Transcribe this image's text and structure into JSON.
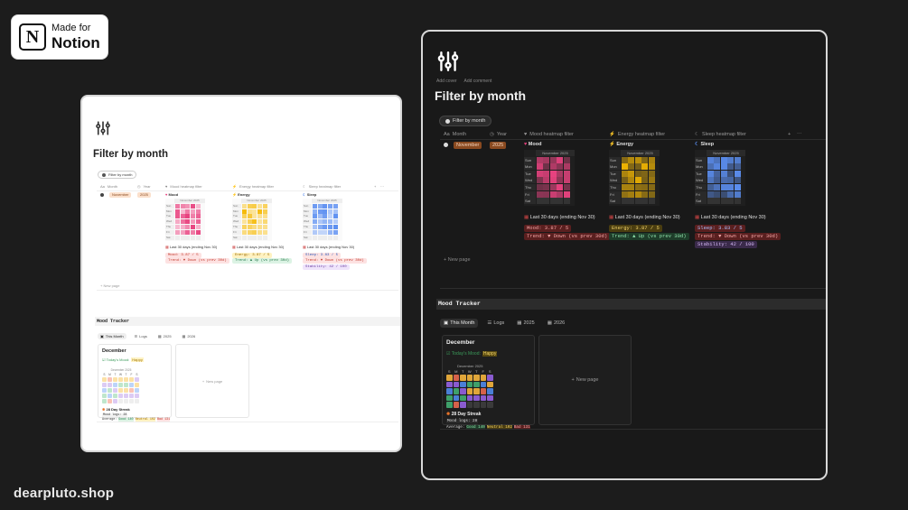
{
  "badge": {
    "small": "Made for",
    "big": "Notion",
    "logo_letter": "N"
  },
  "brand": "dearpluto.shop",
  "page": {
    "title": "Filter by month",
    "add_cover": "Add cover",
    "add_comment": "Add comment",
    "filter_chip": "Filter by month",
    "columns": {
      "name": "Month",
      "year": "Year",
      "mood": "Mood heatmap filter",
      "energy": "Energy heatmap filter",
      "sleep": "Sleep heatmap filter"
    },
    "row": {
      "month": "November",
      "year": "2025"
    },
    "new_page": "New page"
  },
  "heatmap_common": {
    "header": "November 2025",
    "days": [
      "Sun",
      "Mon",
      "Tue",
      "Wed",
      "Thu",
      "Fri",
      "Sat"
    ],
    "last30": "Last 30 days (ending Nov 30)"
  },
  "mood": {
    "label": "Mood",
    "icon": "heart-icon",
    "color": "#e8427f",
    "stat1": "Mood: 3.87 / 5",
    "stat2": "Trend: ▼ Down (vs prev 30d)"
  },
  "energy": {
    "label": "Energy",
    "icon": "lightning-icon",
    "color": "#f5b800",
    "stat1": "Energy: 3.87 / 5",
    "stat2": "Trend: ▲ Up (vs prev 30d)"
  },
  "sleep": {
    "label": "Sleep",
    "icon": "moon-icon",
    "color": "#5b8ef0",
    "stat1": "Sleep: 3.83 / 5",
    "stat2": "Trend: ▼ Down (vs prev 30d)",
    "stat3": "Stability: 42 / 100"
  },
  "tracker": {
    "title": "Mood Tracker",
    "tabs": [
      "This Month",
      "Logs",
      "2025",
      "2026"
    ],
    "card_title": "December",
    "todays_mood_label": "Today's Mood:",
    "todays_mood_value": "Happy",
    "cal_header": "December 2025",
    "weekdays": [
      "S",
      "M",
      "T",
      "W",
      "T",
      "F",
      "S"
    ],
    "streak": "28 Day Streak",
    "mood_logs": "Mood logs: 28",
    "average_label": "Average:",
    "good": "Good 140",
    "neutral": "Neutral 102",
    "bad": "Bad 131",
    "new_page": "New page"
  }
}
